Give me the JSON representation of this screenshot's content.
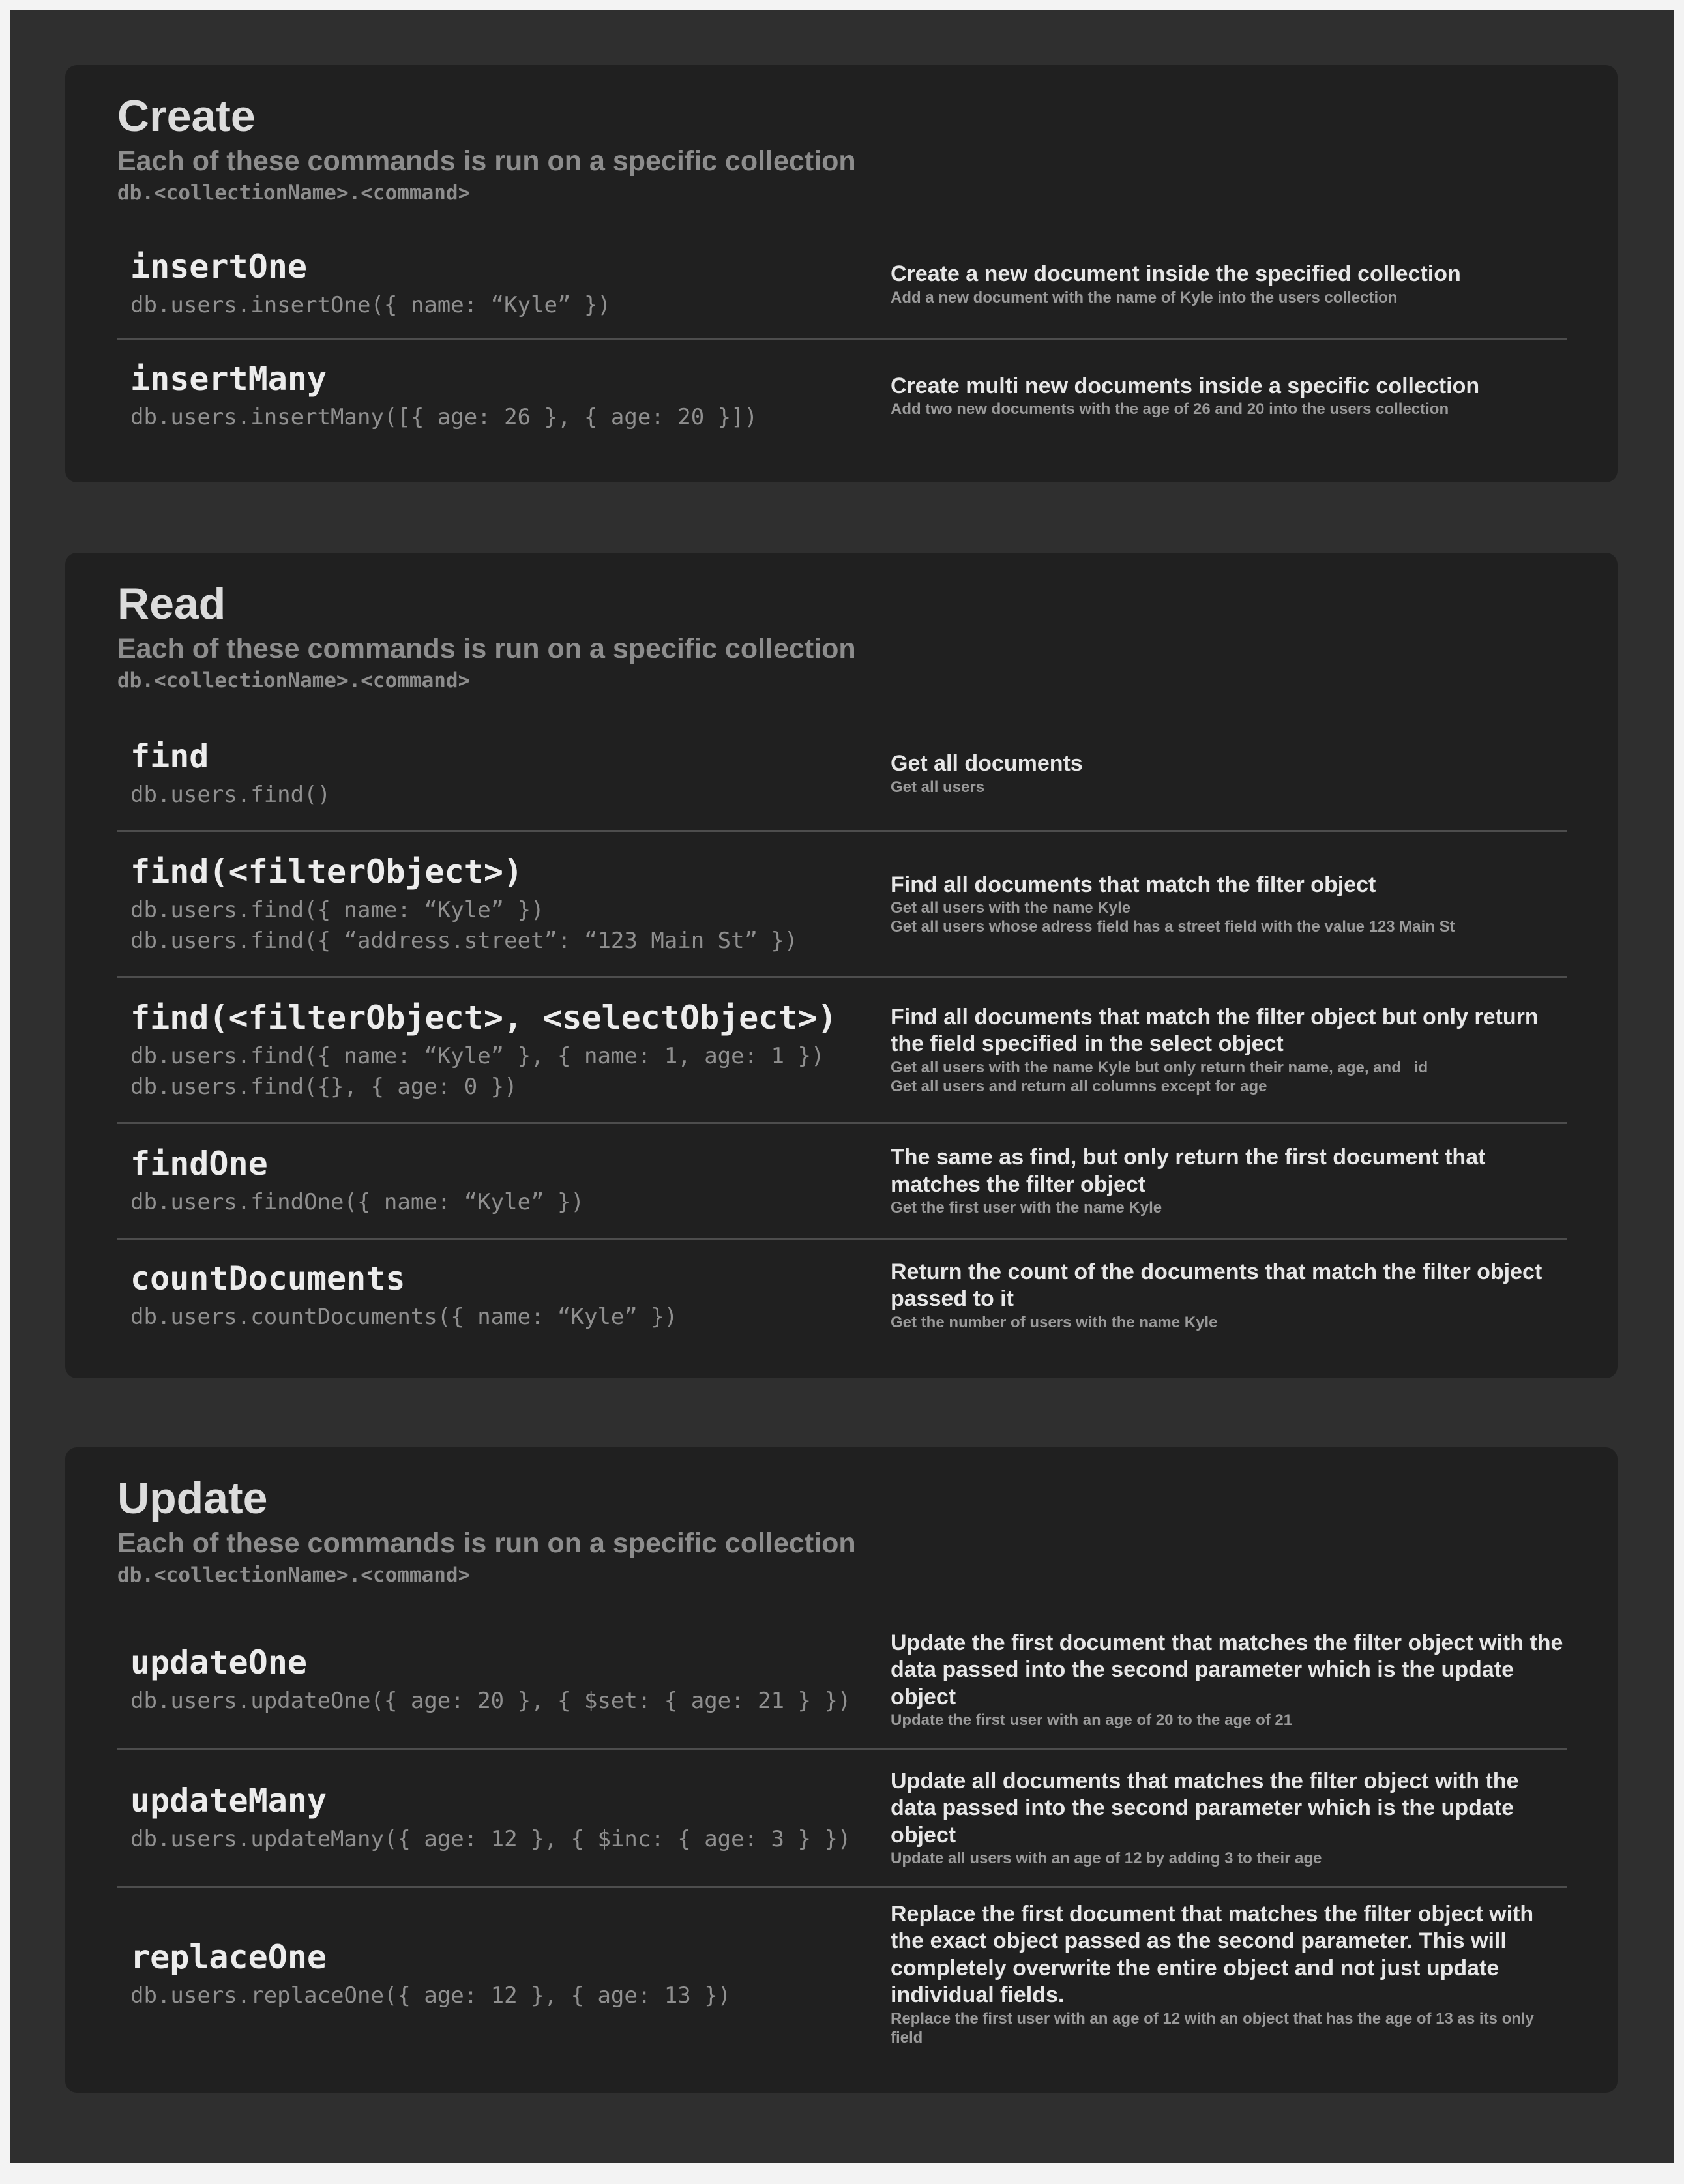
{
  "sections": [
    {
      "title": "Create",
      "subtitle": "Each of these commands is run on a specific collection",
      "syntax": "db.<collectionName>.<command>",
      "rows": [
        {
          "name": "insertOne",
          "examples": [
            "db.users.insertOne({ name: “Kyle” })"
          ],
          "description": "Create a new document inside the specified collection",
          "notes": [
            "Add a new document with the name of Kyle into the users collection"
          ]
        },
        {
          "name": "insertMany",
          "examples": [
            "db.users.insertMany([{ age: 26 }, { age: 20 }])"
          ],
          "description": "Create multi new documents inside a specific collection",
          "notes": [
            "Add two new documents with the age of 26 and 20 into the users collection"
          ]
        }
      ]
    },
    {
      "title": "Read",
      "subtitle": "Each of these commands is run on a specific collection",
      "syntax": "db.<collectionName>.<command>",
      "rows": [
        {
          "name": "find",
          "examples": [
            "db.users.find()"
          ],
          "description": "Get all documents",
          "notes": [
            "Get all users"
          ]
        },
        {
          "name": "find(<filterObject>)",
          "examples": [
            "db.users.find({ name: “Kyle” })",
            "db.users.find({ “address.street”: “123 Main St” })"
          ],
          "description": "Find all documents that match the filter object",
          "notes": [
            "Get all users with the name Kyle",
            "Get all users whose adress field has a street field with the value 123 Main St"
          ]
        },
        {
          "name": "find(<filterObject>, <selectObject>)",
          "examples": [
            "db.users.find({ name: “Kyle” }, { name: 1, age: 1 })",
            "db.users.find({}, { age: 0 })"
          ],
          "description": "Find all documents that match the filter object but only return the field specified in the select object",
          "notes": [
            "Get all users with the name Kyle but only return their name, age, and _id",
            "Get all users and return all columns except for age"
          ]
        },
        {
          "name": "findOne",
          "examples": [
            "db.users.findOne({ name: “Kyle” })"
          ],
          "description": "The same as find, but only return the first document that matches the filter object",
          "notes": [
            "Get the first user with the name Kyle"
          ]
        },
        {
          "name": "countDocuments",
          "examples": [
            "db.users.countDocuments({ name: “Kyle” })"
          ],
          "description": "Return the count of the documents that match the filter object passed to it",
          "notes": [
            "Get the number of users with the name Kyle"
          ]
        }
      ]
    },
    {
      "title": "Update",
      "subtitle": "Each of these commands is run on a specific collection",
      "syntax": "db.<collectionName>.<command>",
      "rows": [
        {
          "name": "updateOne",
          "examples": [
            "db.users.updateOne({ age: 20 }, { $set: { age: 21 } })"
          ],
          "description": "Update the first document that matches the filter object with the data passed into the second parameter which is the update object",
          "notes": [
            "Update the first user with an age of 20 to the age of 21"
          ]
        },
        {
          "name": "updateMany",
          "examples": [
            "db.users.updateMany({ age: 12 }, { $inc: { age: 3 } })"
          ],
          "description": "Update all documents that matches the filter object with the data passed into the second parameter which is the update object",
          "notes": [
            "Update all users with an age of 12 by adding 3 to their age"
          ]
        },
        {
          "name": "replaceOne",
          "examples": [
            "db.users.replaceOne({ age: 12 }, { age: 13 })"
          ],
          "description": "Replace the first document that matches the filter object with the exact object passed as the second parameter. This will completely overwrite the entire object and not just update individual fields.",
          "notes": [
            "Replace the first user with an age of 12 with an object that has the age of 13 as its only field"
          ]
        }
      ]
    }
  ]
}
